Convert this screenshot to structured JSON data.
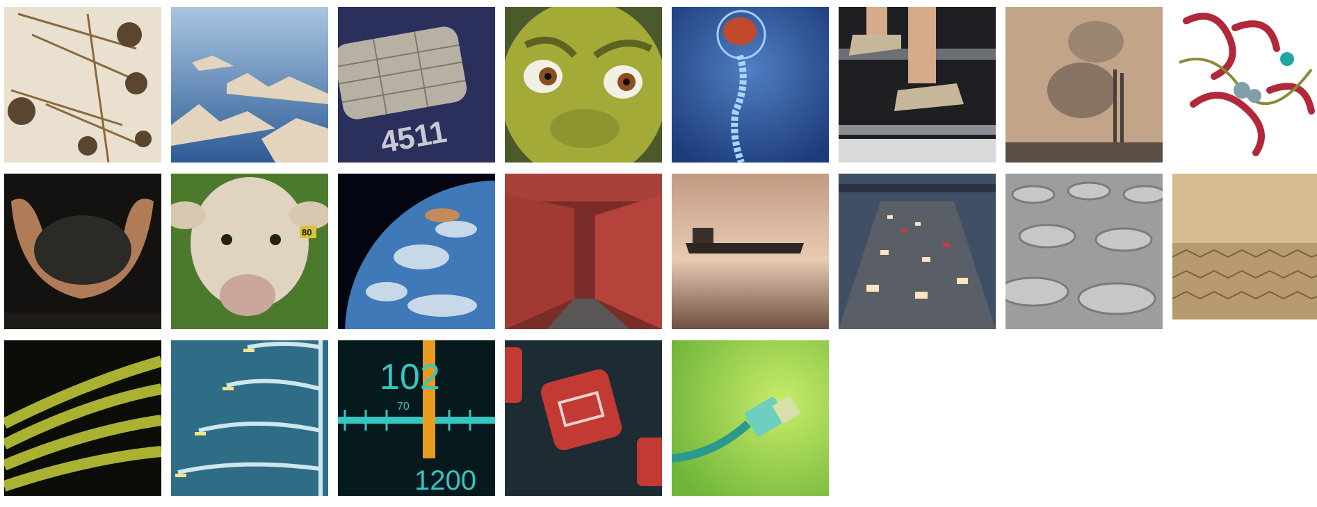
{
  "gallery": {
    "tiles": [
      {
        "subject": "insect-wings-icon"
      },
      {
        "subject": "aerial-mountains-icon"
      },
      {
        "subject": "chip-card-icon",
        "text": "4511"
      },
      {
        "subject": "cartoon-ogre-face-icon"
      },
      {
        "subject": "brain-spine-icon"
      },
      {
        "subject": "stair-climber-feet-icon"
      },
      {
        "subject": "smokestacks-pollution-icon"
      },
      {
        "subject": "protein-ribbon-icon"
      },
      {
        "subject": "hands-holding-soil-icon"
      },
      {
        "subject": "cow-icon",
        "text": "80"
      },
      {
        "subject": "earth-from-space-icon"
      },
      {
        "subject": "shipping-containers-icon"
      },
      {
        "subject": "tanker-ship-icon"
      },
      {
        "subject": "highway-traffic-icon"
      },
      {
        "subject": "ceramic-filters-icon"
      },
      {
        "subject": "corrugated-cardboard-icon"
      },
      {
        "subject": "optical-fibers-icon"
      },
      {
        "subject": "street-lights-icon"
      },
      {
        "subject": "radio-dial-icon",
        "text": "102",
        "text2": "70",
        "text3": "1200"
      },
      {
        "subject": "battery-warning-icon"
      },
      {
        "subject": "ethernet-cable-icon"
      }
    ]
  }
}
